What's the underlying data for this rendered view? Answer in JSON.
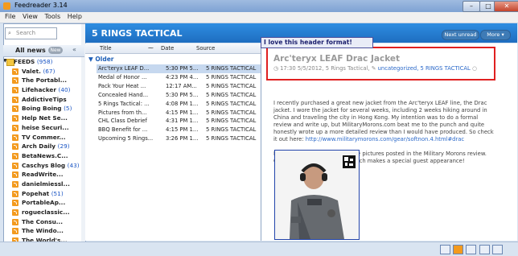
{
  "app": {
    "title": "Feedreader 3.14"
  },
  "menu": [
    "File",
    "View",
    "Tools",
    "Help"
  ],
  "search": {
    "placeholder": "Search"
  },
  "left": {
    "all_news": "All news",
    "new_label": "New"
  },
  "feeds": {
    "root": {
      "name": "FEEDS",
      "count": "(958)"
    },
    "items": [
      {
        "name": "Valet.",
        "count": "(67)"
      },
      {
        "name": "The Portabl...",
        "count": ""
      },
      {
        "name": "Lifehacker",
        "count": "(40)"
      },
      {
        "name": "AddictiveTips",
        "count": ""
      },
      {
        "name": "Boing Boing",
        "count": "(5)"
      },
      {
        "name": "Help Net Se...",
        "count": ""
      },
      {
        "name": "heise Securi...",
        "count": ""
      },
      {
        "name": "TV Commer...",
        "count": ""
      },
      {
        "name": "Arch Daily",
        "count": "(29)"
      },
      {
        "name": "BetaNews.C...",
        "count": ""
      },
      {
        "name": "Caschys Blog",
        "count": "(43)"
      },
      {
        "name": "ReadWrite...",
        "count": ""
      },
      {
        "name": "danielmiessl...",
        "count": ""
      },
      {
        "name": "Popehat",
        "count": "(51)"
      },
      {
        "name": "PortableAp...",
        "count": ""
      },
      {
        "name": "rogueclassic...",
        "count": ""
      },
      {
        "name": "The Consu...",
        "count": ""
      },
      {
        "name": "The Windo...",
        "count": ""
      },
      {
        "name": "The World's...",
        "count": ""
      }
    ]
  },
  "center": {
    "title": "5 RINGS TACTICAL",
    "next_unread": "Next unread",
    "more": "More ▾"
  },
  "list": {
    "columns": {
      "title": "Title",
      "date": "Date",
      "source": "Source"
    },
    "group": "Older",
    "rows": [
      {
        "title": "Arc'teryx LEAF D...",
        "date": "5:30 PM 5...",
        "source": "5 RINGS TACTICAL"
      },
      {
        "title": "Medal of Honor ...",
        "date": "4:23 PM 4...",
        "source": "5 RINGS TACTICAL"
      },
      {
        "title": "Pack Your Heat ...",
        "date": "12:17 AM...",
        "source": "5 RINGS TACTICAL"
      },
      {
        "title": "Concealed Hand...",
        "date": "5:30 PM 5...",
        "source": "5 RINGS TACTICAL"
      },
      {
        "title": "5 Rings Tactical: ...",
        "date": "4:08 PM 1...",
        "source": "5 RINGS TACTICAL"
      },
      {
        "title": "Pictures from th...",
        "date": "4:15 PM 1...",
        "source": "5 RINGS TACTICAL"
      },
      {
        "title": "CHL Class Debrief",
        "date": "4:31 PM 1...",
        "source": "5 RINGS TACTICAL"
      },
      {
        "title": "BBQ Benefit for ...",
        "date": "4:15 PM 1...",
        "source": "5 RINGS TACTICAL"
      },
      {
        "title": "Upcoming 5 Rings...",
        "date": "3:26 PM 1...",
        "source": "5 RINGS TACTICAL"
      }
    ]
  },
  "tooltip": "I love this header format!",
  "article": {
    "title": "Arc'teryx LEAF Drac Jacket",
    "meta_prefix": "17:30 5/5/2012, 5 Rings Tactical,",
    "category": "uncategorized,",
    "source": "5 RINGS TACTICAL",
    "para1": "I recently purchased a great new jacket from the Arc'teryx LEAF line, the Drac jacket.  I wore the jacket for several weeks, including 2 weeks hiking around in China and traveling the city in Hong Kong.  My intention was to do a formal review and write up, but MilitaryMorons.com beat me to the punch and quite honestly wrote up a more detailed review than I would have produced.  So check it out here:",
    "url": "http://www.militarymorons.com/gear/softnon.4.html#drac",
    "para2": "Make sure you check out all the pictures posted in the Military Morons review.  Our 5 Rings Tactical morale patch makes a special guest appearance!"
  },
  "colors": {
    "header_blue": "#1e6dc0",
    "highlight_red": "#e02020",
    "link_blue": "#2a68c9"
  }
}
